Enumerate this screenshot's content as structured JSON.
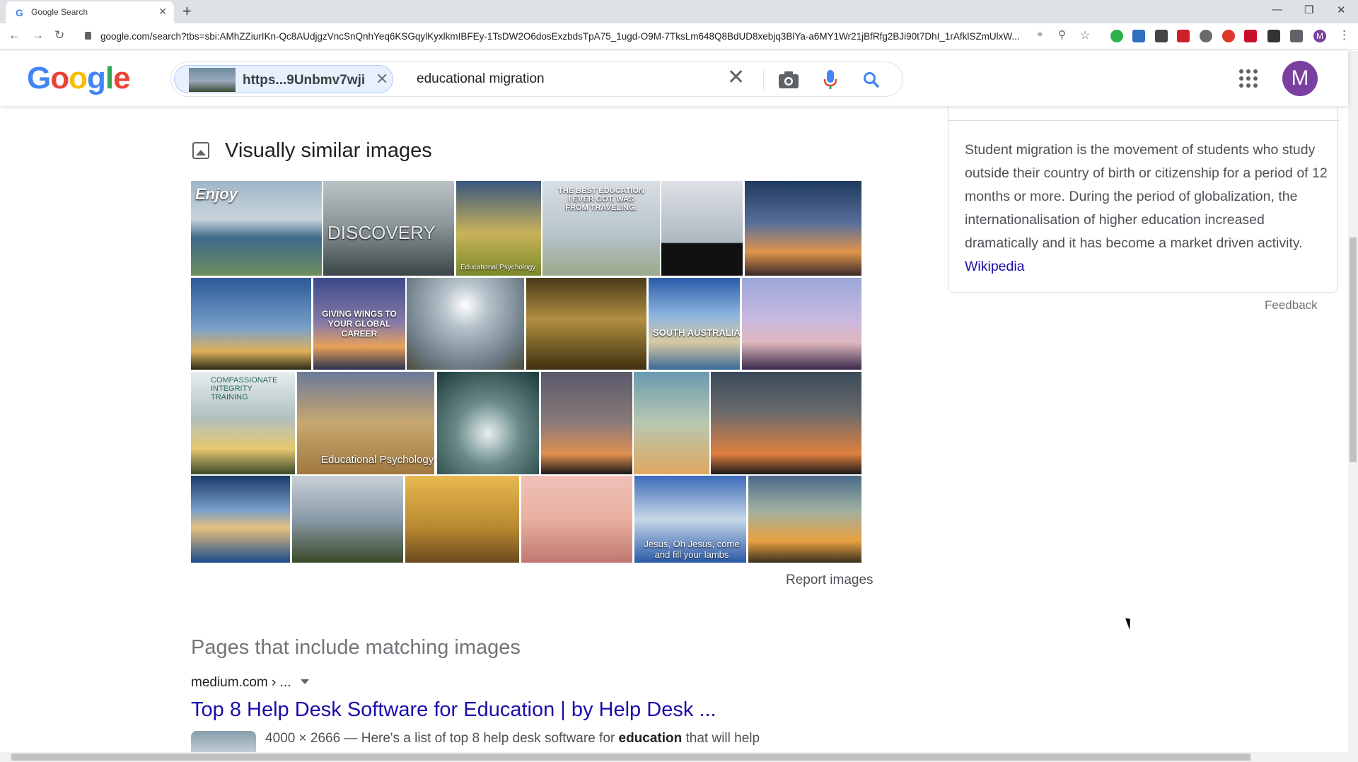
{
  "browser": {
    "tab_title": "Google Search",
    "url": "google.com/search?tbs=sbi:AMhZZiurIKn-Qc8AUdjgzVncSnQnhYeq6KSGqylKyxlkmIBFEy-1TsDW2O6dosExzbdsTpA75_1ugd-O9M-7TksLm648Q8BdUD8xebjq3BlYa-a6MY1Wr21jBfRfg2BJi90t7DhI_1rAfklSZmUlxW...",
    "profile_initial": "M"
  },
  "header": {
    "logo_text": "Google",
    "image_chip_label": "https...9Unbmv7wji",
    "query": "educational migration",
    "avatar_initial": "M"
  },
  "similar": {
    "heading": "Visually similar images",
    "report_label": "Report images",
    "captions": {
      "enjoy": "Enjoy",
      "discovery": "DISCOVERY",
      "edpsych1": "Educational Psychology",
      "best_education": "THE BEST EDUCATION I EVER GOT, WAS FROM TRAVELING.",
      "giving_wings": "GIVING WINGS TO YOUR GLOBAL CAREER",
      "south_australia": "SOUTH AUSTRALIA",
      "compassionate": "COMPASSIONATE INTEGRITY TRAINING",
      "edpsych2": "Educational Psychology",
      "jesus": "Jesus, Oh Jesus, come and fill your lambs"
    }
  },
  "pages": {
    "heading": "Pages that include matching images",
    "result": {
      "cite": "medium.com › ...",
      "title": "Top 8 Help Desk Software for Education | by Help Desk ...",
      "snippet_prefix": "4000 × 2666 — Here's a list of top 8 help desk software for ",
      "snippet_bold": "education",
      "snippet_suffix": " that will help"
    }
  },
  "knowledge_panel": {
    "description": "Student migration is the movement of students who study outside their country of birth or citizenship for a period of 12 months or more. During the period of globalization, the internationalisation of higher education increased dramatically and it has become a market driven activity.",
    "source_link": "Wikipedia",
    "feedback": "Feedback"
  }
}
